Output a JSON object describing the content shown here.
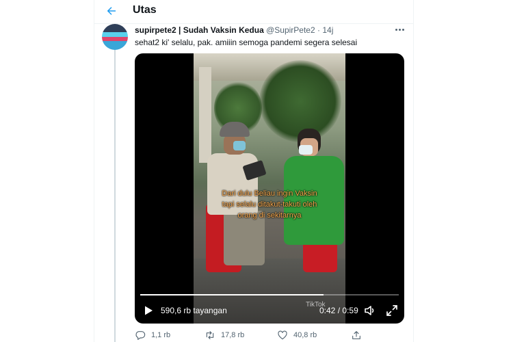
{
  "header": {
    "title": "Utas",
    "back_icon": "arrow-left-icon"
  },
  "tweet": {
    "author_name": "supirpete2 | Sudah Vaksin Kedua",
    "handle": "@SupirPete2",
    "separator": "·",
    "time": "14j",
    "text": "sehat2 ki' selalu, pak. amiiin semoga pandemi segera selesai",
    "more_icon": "more-horizontal-icon"
  },
  "video": {
    "caption_line1": "Dari dulu Beliau ingin Vaksin",
    "caption_line2": "tapi selalu ditakut-takuti oleh",
    "caption_line3": "orang di sekitarnya",
    "watermark": "TikTok",
    "views": "590,6 rb tayangan",
    "current_time": "0:42",
    "time_separator": "/",
    "duration": "0:59",
    "progress": 0.71,
    "icons": {
      "play": "play-icon",
      "volume": "volume-icon",
      "fullscreen": "fullscreen-icon"
    }
  },
  "actions": {
    "reply": {
      "icon": "reply-icon",
      "count": "1,1 rb"
    },
    "retweet": {
      "icon": "retweet-icon",
      "count": "17,8 rb"
    },
    "like": {
      "icon": "heart-icon",
      "count": "40,8 rb"
    },
    "share": {
      "icon": "share-icon"
    }
  },
  "colors": {
    "accent": "#1d9bf0",
    "text_secondary": "#536471",
    "caption": "#f5a54a",
    "thread_line": "#cfd9de"
  }
}
